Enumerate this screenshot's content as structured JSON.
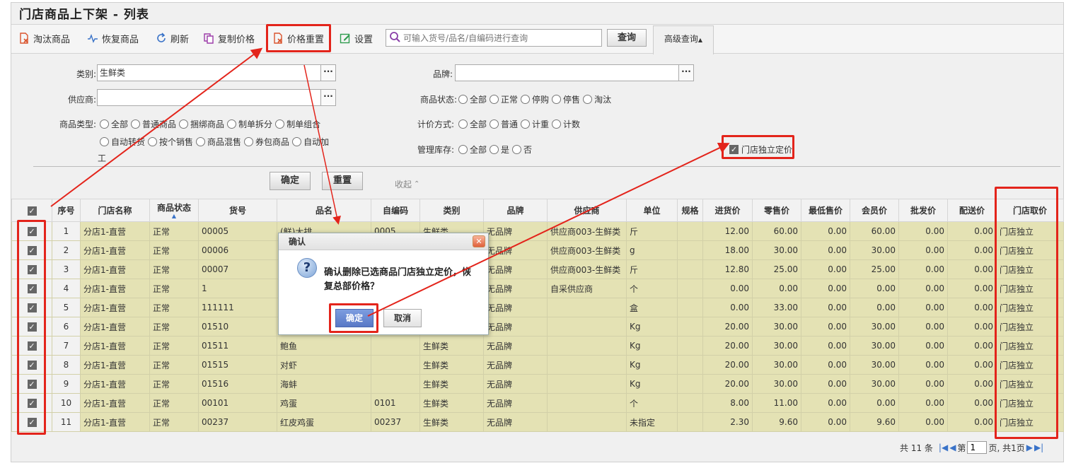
{
  "page": {
    "title": "门店商品上下架 - 列表"
  },
  "toolbar": {
    "items": [
      {
        "label": "淘汰商品",
        "icon": "discard-icon",
        "color": "#d9532c"
      },
      {
        "label": "恢复商品",
        "icon": "pulse-icon",
        "color": "#3a73c8"
      },
      {
        "label": "刷新",
        "icon": "refresh-icon",
        "color": "#3a73c8"
      },
      {
        "label": "复制价格",
        "icon": "copy-icon",
        "color": "#9b3ba8"
      },
      {
        "label": "价格重置",
        "icon": "reset-doc-icon",
        "color": "#d9532c"
      },
      {
        "label": "设置",
        "icon": "edit-icon",
        "color": "#2f9c4e"
      }
    ],
    "search_placeholder": "可输入货号/品名/自编码进行查询",
    "query_label": "查询",
    "advanced_label": "高级查询"
  },
  "filters": {
    "category_label": "类别:",
    "category_value": "生鲜类",
    "brand_label": "品牌:",
    "brand_value": "",
    "supplier_label": "供应商:",
    "supplier_value": "",
    "status_label": "商品状态:",
    "status_options": [
      "全部",
      "正常",
      "停购",
      "停售",
      "淘汰"
    ],
    "type_label": "商品类型:",
    "type_options_row1": [
      "全部",
      "普通商品",
      "捆绑商品",
      "制单拆分",
      "制单组合"
    ],
    "type_options_row2": [
      "自动转货",
      "按个销售",
      "商品混售",
      "券包商品",
      "自动加"
    ],
    "type_wrap": "工",
    "pricing_label": "计价方式:",
    "pricing_options": [
      "全部",
      "普通",
      "计重",
      "计数"
    ],
    "stock_label": "管理库存:",
    "stock_options": [
      "全部",
      "是",
      "否"
    ],
    "independent_label": "门店独立定价",
    "confirm_label": "确定",
    "reset_label": "重置",
    "collapse_label": "收起"
  },
  "grid": {
    "columns": [
      "序号",
      "门店名称",
      "商品状态",
      "货号",
      "品名",
      "自编码",
      "类别",
      "品牌",
      "供应商",
      "单位",
      "规格",
      "进货价",
      "零售价",
      "最低售价",
      "会员价",
      "批发价",
      "配送价",
      "门店取价"
    ],
    "rows": [
      {
        "seq": "1",
        "store": "分店1-直营",
        "status": "正常",
        "code": "00005",
        "name": "(鲜)大排",
        "selfcode": "0005",
        "cat": "生鲜类",
        "brand": "无品牌",
        "supplier": "供应商003-生鲜类",
        "unit": "斤",
        "spec": "",
        "cost": "12.00",
        "retail": "60.00",
        "minp": "0.00",
        "member": "60.00",
        "whole": "0.00",
        "dist": "0.00",
        "take": "门店独立"
      },
      {
        "seq": "2",
        "store": "分店1-直营",
        "status": "正常",
        "code": "00006",
        "name": "",
        "selfcode": "",
        "cat": "",
        "brand": "无品牌",
        "supplier": "供应商003-生鲜类",
        "unit": "g",
        "spec": "",
        "cost": "18.00",
        "retail": "30.00",
        "minp": "0.00",
        "member": "30.00",
        "whole": "0.00",
        "dist": "0.00",
        "take": "门店独立"
      },
      {
        "seq": "3",
        "store": "分店1-直营",
        "status": "正常",
        "code": "00007",
        "name": "",
        "selfcode": "",
        "cat": "",
        "brand": "无品牌",
        "supplier": "供应商003-生鲜类",
        "unit": "斤",
        "spec": "",
        "cost": "12.80",
        "retail": "25.00",
        "minp": "0.00",
        "member": "25.00",
        "whole": "0.00",
        "dist": "0.00",
        "take": "门店独立"
      },
      {
        "seq": "4",
        "store": "分店1-直营",
        "status": "正常",
        "code": "1",
        "name": "",
        "selfcode": "",
        "cat": "",
        "brand": "无品牌",
        "supplier": "自采供应商",
        "unit": "个",
        "spec": "",
        "cost": "0.00",
        "retail": "0.00",
        "minp": "0.00",
        "member": "0.00",
        "whole": "0.00",
        "dist": "0.00",
        "take": "门店独立"
      },
      {
        "seq": "5",
        "store": "分店1-直营",
        "status": "正常",
        "code": "111111",
        "name": "",
        "selfcode": "",
        "cat": "",
        "brand": "无品牌",
        "supplier": "",
        "unit": "盒",
        "spec": "",
        "cost": "0.00",
        "retail": "33.00",
        "minp": "0.00",
        "member": "0.00",
        "whole": "0.00",
        "dist": "0.00",
        "take": "门店独立"
      },
      {
        "seq": "6",
        "store": "分店1-直营",
        "status": "正常",
        "code": "01510",
        "name": "",
        "selfcode": "",
        "cat": "",
        "brand": "无品牌",
        "supplier": "",
        "unit": "Kg",
        "spec": "",
        "cost": "20.00",
        "retail": "30.00",
        "minp": "0.00",
        "member": "30.00",
        "whole": "0.00",
        "dist": "0.00",
        "take": "门店独立"
      },
      {
        "seq": "7",
        "store": "分店1-直营",
        "status": "正常",
        "code": "01511",
        "name": "鲍鱼",
        "selfcode": "",
        "cat": "生鲜类",
        "brand": "无品牌",
        "supplier": "",
        "unit": "Kg",
        "spec": "",
        "cost": "20.00",
        "retail": "30.00",
        "minp": "0.00",
        "member": "30.00",
        "whole": "0.00",
        "dist": "0.00",
        "take": "门店独立"
      },
      {
        "seq": "8",
        "store": "分店1-直营",
        "status": "正常",
        "code": "01515",
        "name": "对虾",
        "selfcode": "",
        "cat": "生鲜类",
        "brand": "无品牌",
        "supplier": "",
        "unit": "Kg",
        "spec": "",
        "cost": "20.00",
        "retail": "30.00",
        "minp": "0.00",
        "member": "30.00",
        "whole": "0.00",
        "dist": "0.00",
        "take": "门店独立"
      },
      {
        "seq": "9",
        "store": "分店1-直营",
        "status": "正常",
        "code": "01516",
        "name": "海蚌",
        "selfcode": "",
        "cat": "生鲜类",
        "brand": "无品牌",
        "supplier": "",
        "unit": "Kg",
        "spec": "",
        "cost": "20.00",
        "retail": "30.00",
        "minp": "0.00",
        "member": "30.00",
        "whole": "0.00",
        "dist": "0.00",
        "take": "门店独立"
      },
      {
        "seq": "10",
        "store": "分店1-直营",
        "status": "正常",
        "code": "00101",
        "name": "鸡蛋",
        "selfcode": "0101",
        "cat": "生鲜类",
        "brand": "无品牌",
        "supplier": "",
        "unit": "个",
        "spec": "",
        "cost": "8.00",
        "retail": "11.00",
        "minp": "0.00",
        "member": "0.00",
        "whole": "0.00",
        "dist": "0.00",
        "take": "门店独立"
      },
      {
        "seq": "11",
        "store": "分店1-直营",
        "status": "正常",
        "code": "00237",
        "name": "红皮鸡蛋",
        "selfcode": "00237",
        "cat": "生鲜类",
        "brand": "无品牌",
        "supplier": "",
        "unit": "未指定",
        "spec": "",
        "cost": "2.30",
        "retail": "9.60",
        "minp": "0.00",
        "member": "9.60",
        "whole": "0.00",
        "dist": "0.00",
        "take": "门店独立"
      }
    ]
  },
  "pager": {
    "total": "共 11 条",
    "page_prefix": "第",
    "page_value": "1",
    "page_suffix": "页, 共1页"
  },
  "dialog": {
    "title": "确认",
    "message": "确认删除已选商品门店独立定价，恢复总部价格？",
    "ok_label": "确定",
    "cancel_label": "取消"
  },
  "colors": {
    "highlight": "#e3241b",
    "row_bg": "#e4e2b4",
    "ok_btn": "#5878c6"
  }
}
